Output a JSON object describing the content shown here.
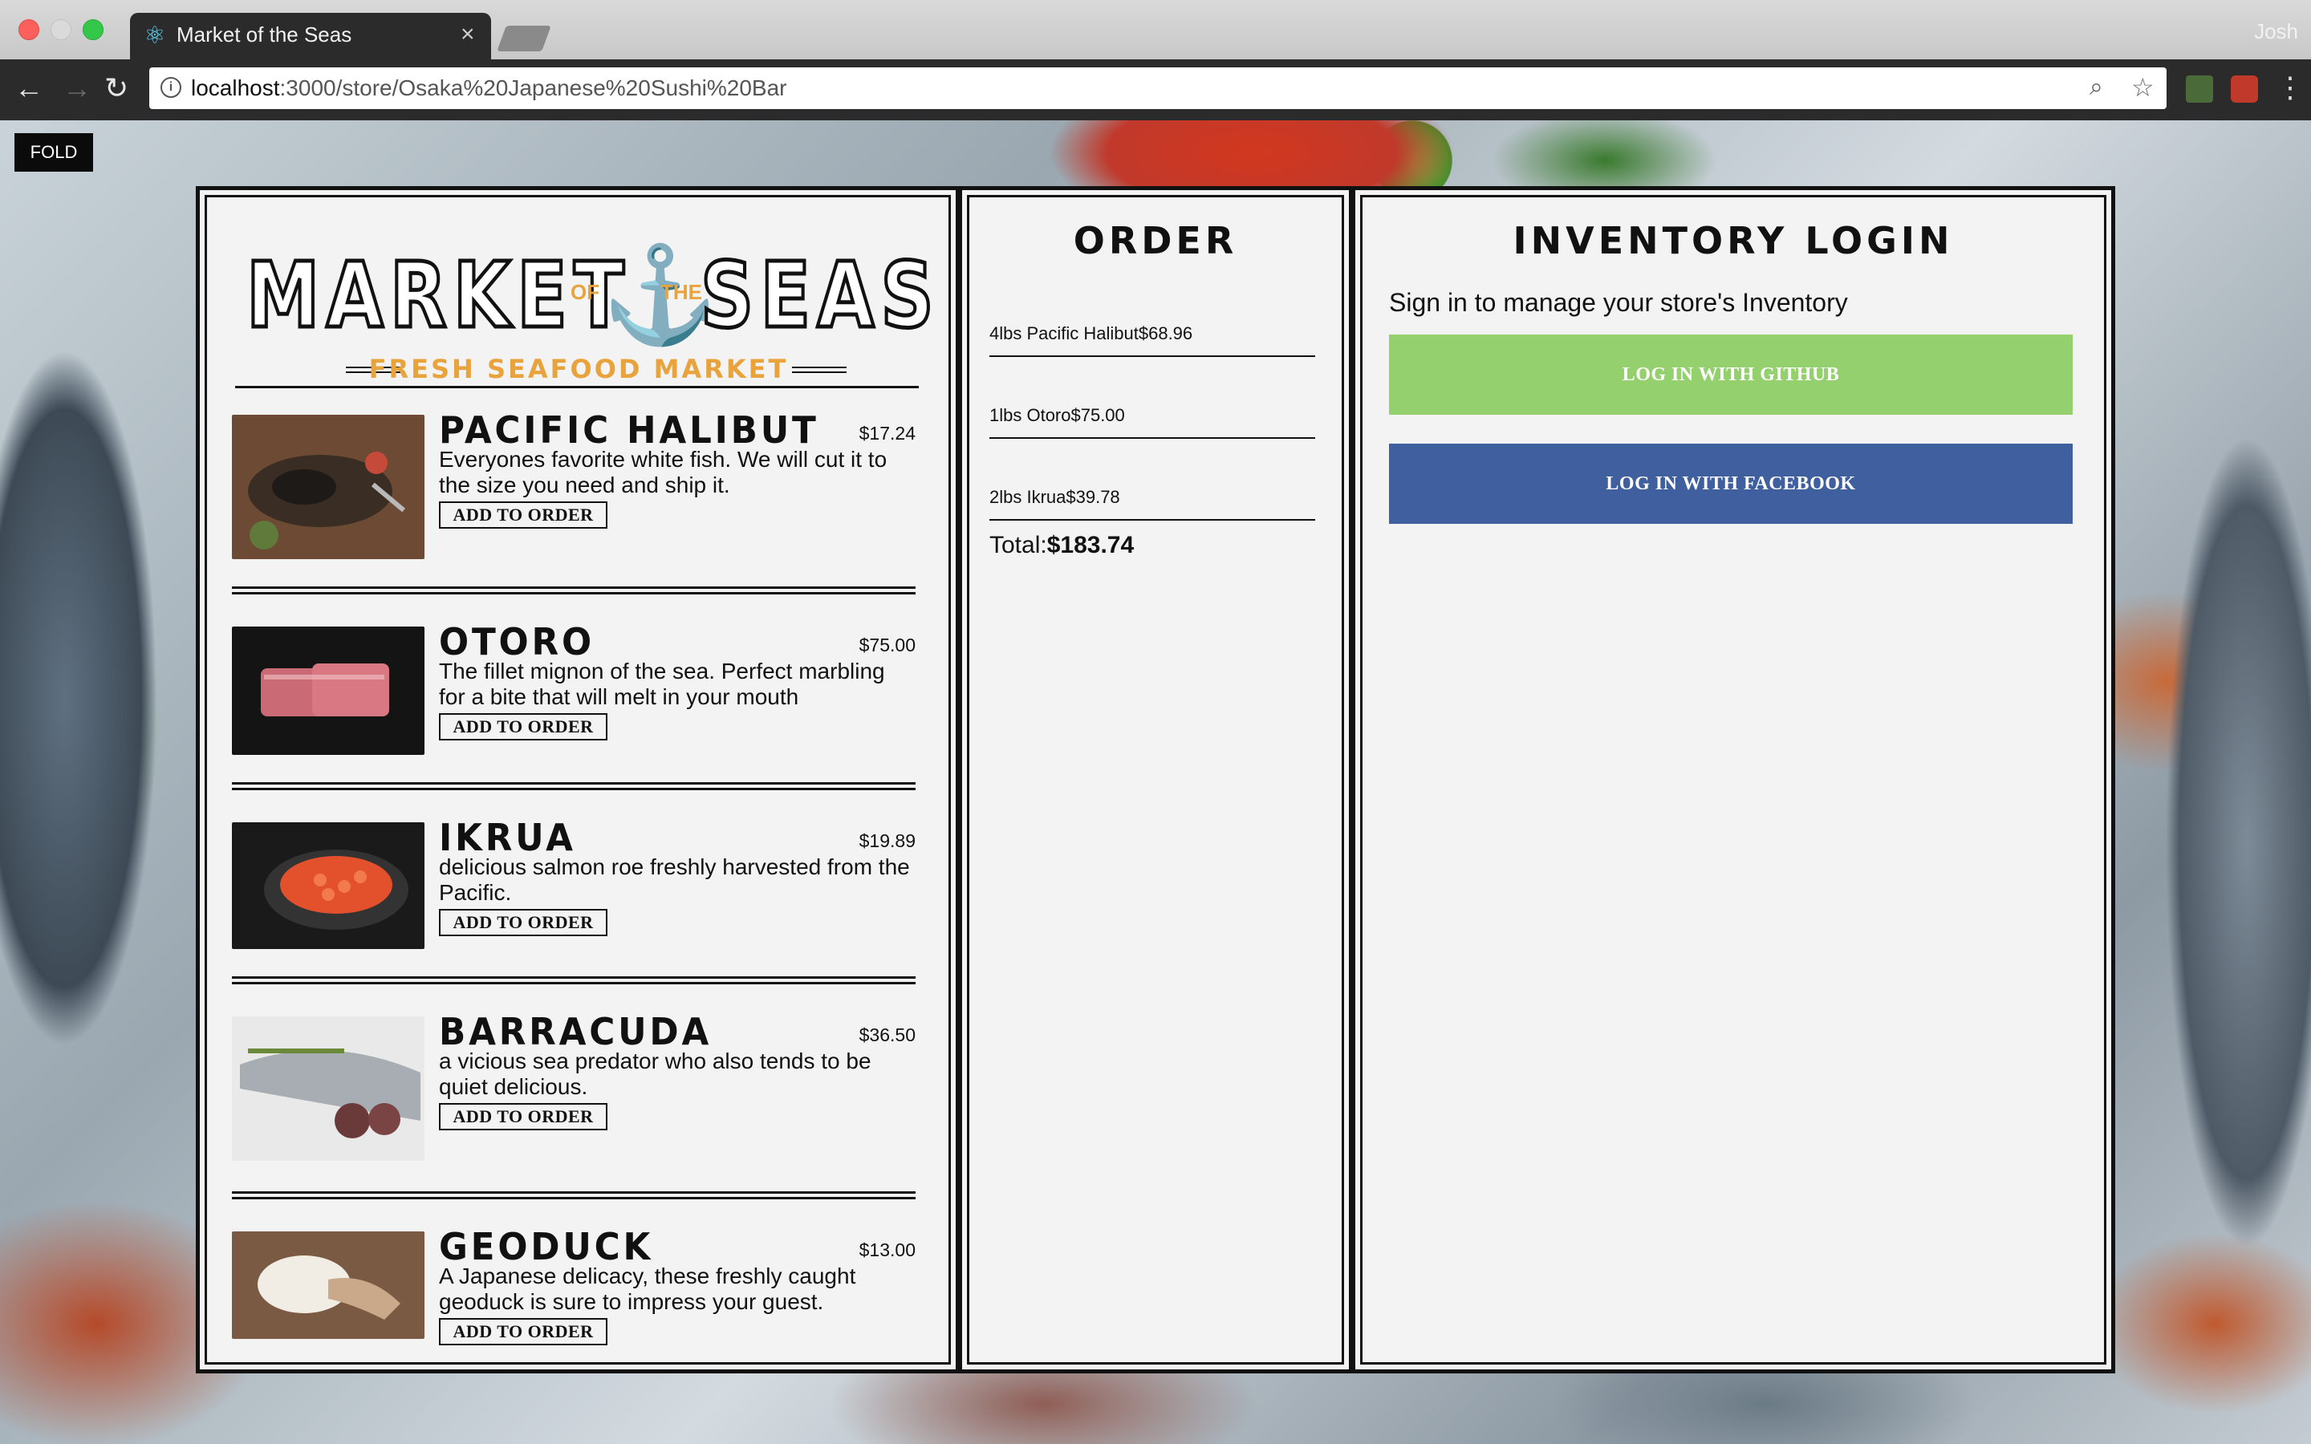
{
  "browser": {
    "tab_title": "Market of the Seas",
    "url_host": "localhost",
    "url_path": ":3000/store/Osaka%20Japanese%20Sushi%20Bar",
    "profile_name": "Josh",
    "tab_close": "×"
  },
  "page": {
    "fold_label": "FOLD"
  },
  "logo": {
    "left_word": "MARKET",
    "of": "OF",
    "the": "THE",
    "right_word": "SEAS",
    "tagline": "FRESH SEAFOOD MARKET"
  },
  "menu": {
    "add_label": "ADD TO ORDER",
    "fishes": [
      {
        "name": "PACIFIC HALIBUT",
        "price": "$17.24",
        "desc": "Everyones favorite white fish. We will cut it to the size you need and ship it."
      },
      {
        "name": "OTORO",
        "price": "$75.00",
        "desc": "The fillet mignon of the sea. Perfect marbling for a bite that will melt in your mouth"
      },
      {
        "name": "IKRUA",
        "price": "$19.89",
        "desc": "delicious salmon roe freshly harvested from the Pacific."
      },
      {
        "name": "BARRACUDA",
        "price": "$36.50",
        "desc": "a vicious sea predator who also tends to be quiet delicious."
      },
      {
        "name": "GEODUCK",
        "price": "$13.00",
        "desc": "A Japanese delicacy, these freshly caught geoduck is sure to impress your guest."
      }
    ]
  },
  "order": {
    "title": "ORDER",
    "items": [
      "4lbs Pacific Halibut$68.96",
      "1lbs Otoro$75.00",
      "2lbs Ikrua$39.78"
    ],
    "total_label": "Total:",
    "total_value": "$183.74"
  },
  "inventory": {
    "title": "INVENTORY LOGIN",
    "subtitle": "Sign in to manage your store's Inventory",
    "github_label": "LOG IN WITH GITHUB",
    "facebook_label": "LOG IN WITH FACEBOOK"
  },
  "colors": {
    "github_green": "#94d06d",
    "facebook_blue": "#3f5f9f",
    "accent_orange": "#e8a33d",
    "panel_bg": "#f3f3f3"
  }
}
